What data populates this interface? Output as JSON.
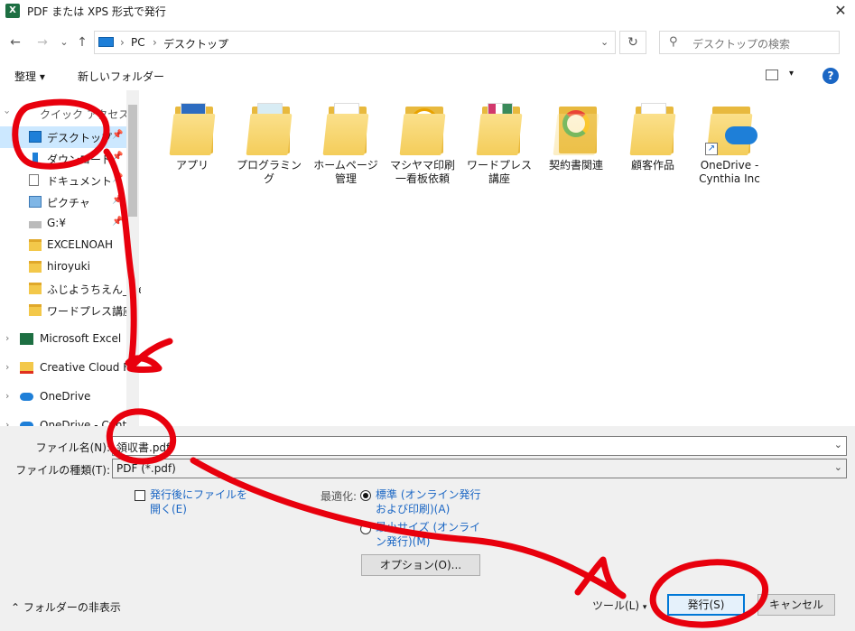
{
  "window": {
    "title": "PDF または XPS 形式で発行",
    "app_icon_letter": "X",
    "close_glyph": "✕"
  },
  "nav": {
    "back": "←",
    "forward": "→",
    "recent": "⌄",
    "up": "↑",
    "address": [
      "PC",
      "デスクトップ"
    ],
    "separator": "›",
    "refresh": "↻",
    "search_placeholder": "デスクトップの検索"
  },
  "toolbar": {
    "organize": "整理 ▾",
    "new_folder": "新しいフォルダー",
    "view_arrow": "▾",
    "help": "?"
  },
  "sidebar": {
    "quick_access_label": "クイック アクセス",
    "quick_items": [
      {
        "label": "デスクトップ",
        "icon": "desktop-icon"
      },
      {
        "label": "ダウンロード",
        "icon": "download-icon"
      },
      {
        "label": "ドキュメント",
        "icon": "document-icon"
      },
      {
        "label": "ピクチャ",
        "icon": "picture-icon"
      },
      {
        "label": "G:¥",
        "icon": "drive-icon"
      },
      {
        "label": "EXCELNOAH",
        "icon": "folder-icon"
      },
      {
        "label": "hiroyuki",
        "icon": "folder-icon"
      },
      {
        "label": "ふじようちえん_file",
        "icon": "folder-icon"
      },
      {
        "label": "ワードプレス講座",
        "icon": "folder-icon"
      }
    ],
    "roots": [
      {
        "label": "Microsoft Excel",
        "icon": "excel-icon"
      },
      {
        "label": "Creative Cloud F",
        "icon": "creative-cloud-icon"
      },
      {
        "label": "OneDrive",
        "icon": "onedrive-icon"
      },
      {
        "label": "OneDrive - Cynt",
        "icon": "onedrive-icon"
      }
    ],
    "expand_glyph": "›"
  },
  "files": [
    {
      "label": "アプリ"
    },
    {
      "label": "プログラミング"
    },
    {
      "label": "ホームページ管理"
    },
    {
      "label": "マシヤマ印刷一看板依頼"
    },
    {
      "label": "ワードプレス講座"
    },
    {
      "label": "契約書関連"
    },
    {
      "label": "顧客作品"
    },
    {
      "label": "OneDrive - Cynthia Inc"
    }
  ],
  "form": {
    "filename_label": "ファイル名(N):",
    "filename_value": "領収書.pdf",
    "filetype_label": "ファイルの種類(T):",
    "filetype_value": "PDF (*.pdf)",
    "open_after_label": "発行後にファイルを開く(E)",
    "optimize_label": "最適化:",
    "opt_standard": "標準 (オンライン発行および印刷)(A)",
    "opt_minimum": "最小サイズ (オンライン発行)(M)",
    "options_button": "オプション(O)..."
  },
  "footer": {
    "hide_folders": "フォルダーの非表示",
    "tools": "ツール(L)",
    "publish": "発行(S)",
    "cancel": "キャンセル"
  },
  "colors": {
    "accent": "#0078d7",
    "annotation": "#e8000d",
    "selection": "#cce8ff",
    "link": "#1a66c4"
  }
}
